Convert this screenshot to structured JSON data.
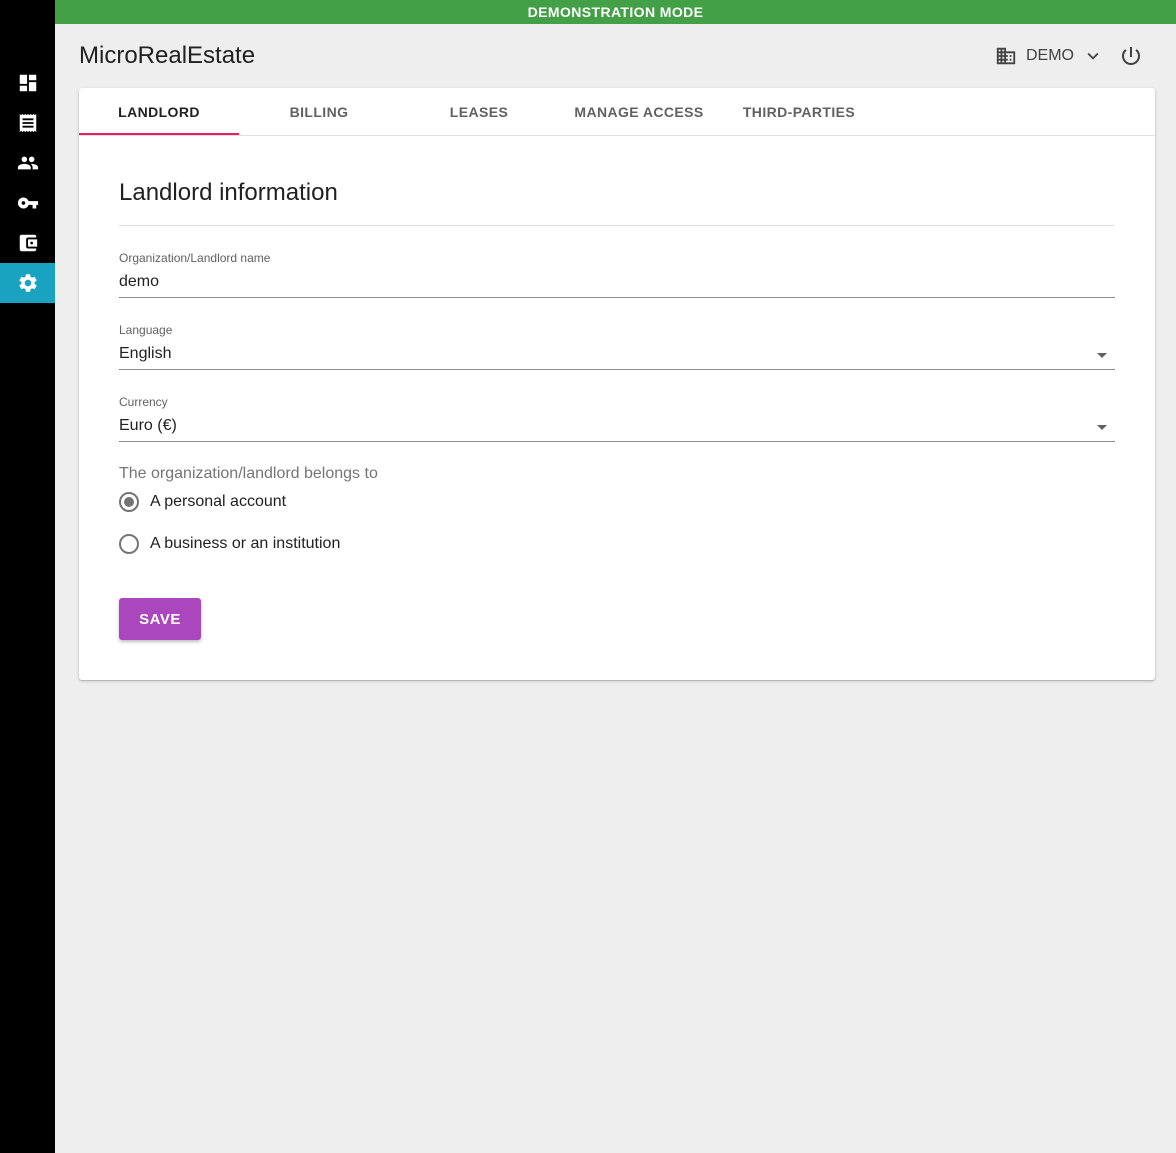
{
  "banner": {
    "text": "DEMONSTRATION MODE",
    "color": "#43a047"
  },
  "app": {
    "title": "MicroRealEstate"
  },
  "sidebar": {
    "items": [
      {
        "icon": "dashboard-icon",
        "active": false
      },
      {
        "icon": "receipt-icon",
        "active": false
      },
      {
        "icon": "people-icon",
        "active": false
      },
      {
        "icon": "key-icon",
        "active": false
      },
      {
        "icon": "wallet-icon",
        "active": false
      },
      {
        "icon": "gear-icon",
        "active": true
      }
    ],
    "active_color": "#1aa3c1"
  },
  "header": {
    "org_icon": "building-icon",
    "org_name": "DEMO",
    "dropdown_icon": "chevron-down-icon",
    "power_icon": "power-icon"
  },
  "tabs": [
    {
      "label": "LANDLORD",
      "active": true
    },
    {
      "label": "BILLING",
      "active": false
    },
    {
      "label": "LEASES",
      "active": false
    },
    {
      "label": "MANAGE ACCESS",
      "active": false
    },
    {
      "label": "THIRD-PARTIES",
      "active": false
    }
  ],
  "form": {
    "title": "Landlord information",
    "name_label": "Organization/Landlord name",
    "name_value": "demo",
    "language_label": "Language",
    "language_value": "English",
    "currency_label": "Currency",
    "currency_value": "Euro (€)",
    "belongs_label": "The organization/landlord belongs to",
    "options": [
      {
        "label": "A personal account",
        "selected": true
      },
      {
        "label": "A business or an institution",
        "selected": false
      }
    ],
    "save_label": "SAVE",
    "save_color": "#ab47bc"
  }
}
